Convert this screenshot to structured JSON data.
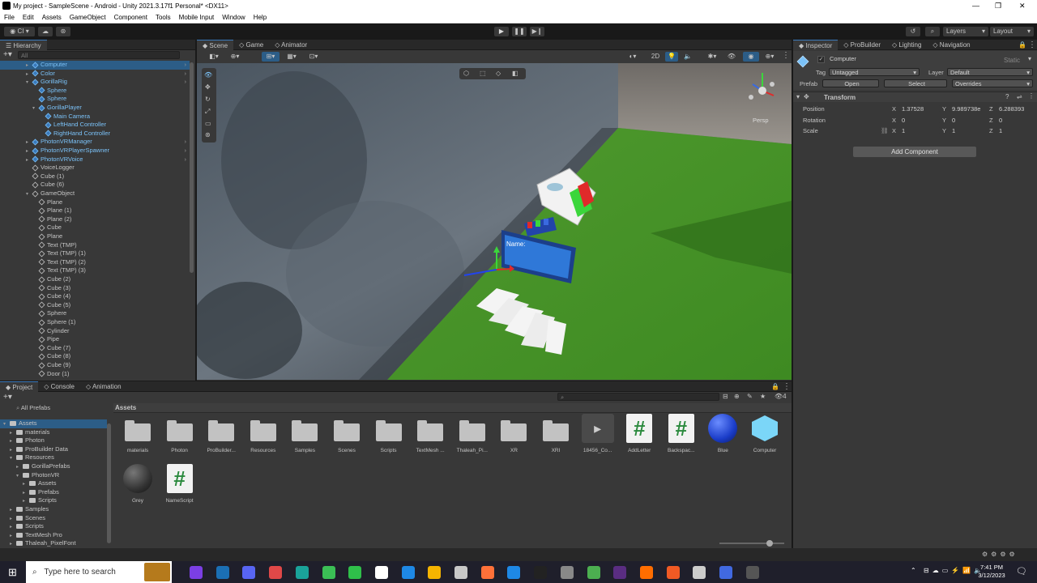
{
  "window": {
    "title": "My project - SampleScene - Android - Unity 2021.3.17f1 Personal* <DX11>"
  },
  "menu": [
    "File",
    "Edit",
    "Assets",
    "GameObject",
    "Component",
    "Tools",
    "Mobile Input",
    "Window",
    "Help"
  ],
  "toolbar": {
    "layers_label": "Layers",
    "layout_label": "Layout",
    "account_label": "CI"
  },
  "hierarchy": {
    "tab": "Hierarchy",
    "search_placeholder": "All",
    "items": [
      {
        "label": "Computer",
        "indent": 2,
        "prefab": true,
        "selected": true,
        "arrow": true
      },
      {
        "label": "Color",
        "indent": 2,
        "prefab": true,
        "arrow": true
      },
      {
        "label": "GorillaRig",
        "indent": 2,
        "prefab": true,
        "arrow": true,
        "open": true
      },
      {
        "label": "Sphere",
        "indent": 3,
        "prefab": true
      },
      {
        "label": "Sphere",
        "indent": 3,
        "prefab": true
      },
      {
        "label": "GorillaPlayer",
        "indent": 3,
        "prefab": true,
        "open": true
      },
      {
        "label": "Main Camera",
        "indent": 4,
        "prefab": true
      },
      {
        "label": "LeftHand Controller",
        "indent": 4,
        "prefab": true
      },
      {
        "label": "RightHand Controller",
        "indent": 4,
        "prefab": true
      },
      {
        "label": "PhotonVRManager",
        "indent": 2,
        "prefab": true,
        "arrow": true
      },
      {
        "label": "PhotonVRPlayerSpawner",
        "indent": 2,
        "prefab": true,
        "arrow": true
      },
      {
        "label": "PhotonVRVoice",
        "indent": 2,
        "prefab": true,
        "arrow": true
      },
      {
        "label": "VoiceLogger",
        "indent": 2
      },
      {
        "label": "Cube (1)",
        "indent": 2
      },
      {
        "label": "Cube (6)",
        "indent": 2
      },
      {
        "label": "GameObject",
        "indent": 2,
        "open": true
      },
      {
        "label": "Plane",
        "indent": 3
      },
      {
        "label": "Plane (1)",
        "indent": 3
      },
      {
        "label": "Plane (2)",
        "indent": 3
      },
      {
        "label": "Cube",
        "indent": 3
      },
      {
        "label": "Plane",
        "indent": 3
      },
      {
        "label": "Text (TMP)",
        "indent": 3
      },
      {
        "label": "Text (TMP) (1)",
        "indent": 3
      },
      {
        "label": "Text (TMP) (2)",
        "indent": 3
      },
      {
        "label": "Text (TMP) (3)",
        "indent": 3
      },
      {
        "label": "Cube (2)",
        "indent": 3
      },
      {
        "label": "Cube (3)",
        "indent": 3
      },
      {
        "label": "Cube (4)",
        "indent": 3
      },
      {
        "label": "Cube (5)",
        "indent": 3
      },
      {
        "label": "Sphere",
        "indent": 3
      },
      {
        "label": "Sphere (1)",
        "indent": 3
      },
      {
        "label": "Cylinder",
        "indent": 3
      },
      {
        "label": "Pipe",
        "indent": 3
      },
      {
        "label": "Cube (7)",
        "indent": 3
      },
      {
        "label": "Cube (8)",
        "indent": 3
      },
      {
        "label": "Cube (9)",
        "indent": 3
      },
      {
        "label": "Door (1)",
        "indent": 3
      }
    ]
  },
  "scene": {
    "tabs": [
      "Scene",
      "Game",
      "Animator"
    ],
    "mode_2d": "2D",
    "persp_label": "Persp",
    "name_label": "Name:"
  },
  "inspector": {
    "tabs": [
      "Inspector",
      "ProBuilder",
      "Lighting",
      "Navigation"
    ],
    "object_name": "Computer",
    "static_label": "Static",
    "tag_label": "Tag",
    "tag_value": "Untagged",
    "layer_label": "Layer",
    "layer_value": "Default",
    "prefab_label": "Prefab",
    "open_label": "Open",
    "select_label": "Select",
    "overrides_label": "Overrides",
    "component_title": "Transform",
    "position": {
      "label": "Position",
      "x": "1.37528",
      "y": "9.989738e",
      "z": "6.288393"
    },
    "rotation": {
      "label": "Rotation",
      "x": "0",
      "y": "0",
      "z": "0"
    },
    "scale": {
      "label": "Scale",
      "x": "1",
      "y": "1",
      "z": "1"
    },
    "add_component": "Add Component"
  },
  "project": {
    "tabs": [
      "Project",
      "Console",
      "Animation"
    ],
    "all_prefabs": "All Prefabs",
    "breadcrumb": "Assets",
    "tree": [
      {
        "label": "Assets",
        "indent": 0,
        "open": true
      },
      {
        "label": "materials",
        "indent": 1
      },
      {
        "label": "Photon",
        "indent": 1
      },
      {
        "label": "ProBuilder Data",
        "indent": 1
      },
      {
        "label": "Resources",
        "indent": 1,
        "open": true
      },
      {
        "label": "GorillaPrefabs",
        "indent": 2
      },
      {
        "label": "PhotonVR",
        "indent": 2,
        "open": true
      },
      {
        "label": "Assets",
        "indent": 3
      },
      {
        "label": "Prefabs",
        "indent": 3
      },
      {
        "label": "Scripts",
        "indent": 3
      },
      {
        "label": "Samples",
        "indent": 1
      },
      {
        "label": "Scenes",
        "indent": 1
      },
      {
        "label": "Scripts",
        "indent": 1
      },
      {
        "label": "TextMesh Pro",
        "indent": 1
      },
      {
        "label": "Thaleah_PixelFont",
        "indent": 1
      }
    ],
    "assets_row1": [
      {
        "label": "materials",
        "kind": "folder"
      },
      {
        "label": "Photon",
        "kind": "folder"
      },
      {
        "label": "ProBuilder...",
        "kind": "folder"
      },
      {
        "label": "Resources",
        "kind": "folder"
      },
      {
        "label": "Samples",
        "kind": "folder"
      },
      {
        "label": "Scenes",
        "kind": "folder"
      },
      {
        "label": "Scripts",
        "kind": "folder"
      },
      {
        "label": "TextMesh ...",
        "kind": "folder"
      },
      {
        "label": "Thaleah_Pi...",
        "kind": "folder"
      },
      {
        "label": "XR",
        "kind": "folder"
      },
      {
        "label": "XRI",
        "kind": "folder"
      },
      {
        "label": "18456_Co...",
        "kind": "model"
      },
      {
        "label": "AddLetter",
        "kind": "script"
      },
      {
        "label": "Backspac...",
        "kind": "script"
      },
      {
        "label": "Blue",
        "kind": "material"
      },
      {
        "label": "Computer",
        "kind": "prefab"
      }
    ],
    "assets_row2": [
      {
        "label": "Grey",
        "kind": "material-grey"
      },
      {
        "label": "NameScript",
        "kind": "script"
      }
    ],
    "hidden_count": "4"
  },
  "taskbar": {
    "search_placeholder": "Type here to search",
    "time": "7:41 PM",
    "date": "3/12/2023"
  }
}
